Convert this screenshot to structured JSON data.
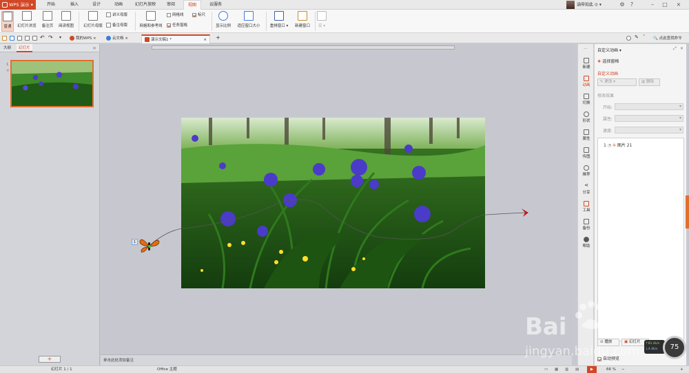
{
  "app": {
    "name": "WPS 演示",
    "user": "涵帝如此"
  },
  "menu": [
    "开始",
    "插入",
    "设计",
    "动画",
    "幻灯片放映",
    "审阅",
    "视图",
    "云服务"
  ],
  "active_menu": "视图",
  "ribbon": {
    "normal": "普通",
    "slide_sorter": "幻灯片浏览",
    "notes_page": "备注页",
    "reading_view": "阅读视图",
    "slide_master": "幻灯片母版",
    "handout_master": "讲义母版",
    "notes_master": "备注母版",
    "grid_guides": "网格和参考线",
    "gridlines": "网格线",
    "ruler": "标尺",
    "task_pane": "任务窗格",
    "zoom": "显示比例",
    "fit_window": "适应窗口大小",
    "arrange": "重排窗口",
    "new_window": "新建窗口",
    "macro": "宏"
  },
  "tabs": {
    "my_wps": "我的WPS",
    "cloud": "云文档",
    "document": "演示文稿1 *",
    "find": "点此查找命令"
  },
  "left_panel": {
    "outline": "大纲",
    "slides": "幻灯片",
    "slide_number": "1"
  },
  "canvas": {
    "notes_placeholder": "单击此处添加备注",
    "anim_badge": "1"
  },
  "sidebar": [
    "新建",
    "动画",
    "切换",
    "形状",
    "属性",
    "传图",
    "推荐",
    "分享",
    "工具",
    "备份",
    "帮助"
  ],
  "sidebar_active": "动画",
  "anim_pane": {
    "title": "自定义动画",
    "select_pane": "选择窗格",
    "section": "自定义动画",
    "change": "更改",
    "remove": "删除",
    "modify": "修改效果",
    "start": "开始:",
    "property": "属性:",
    "speed": "速度:",
    "item_number": "1",
    "item_name": "图片 21",
    "play": "播放",
    "slideshow": "幻灯片",
    "autopreview": "自动预览"
  },
  "statusbar": {
    "slide": "幻灯片 1 / 1",
    "theme": "Office 主题",
    "zoom": "66 %"
  },
  "watermark": {
    "brand": "Baidu经验",
    "url": "jingyan.baidu.com"
  },
  "overlay": {
    "zoom_badge": "75",
    "up": "↑81.4k/s",
    "down": "↓4.4k/s"
  },
  "colors": {
    "accent": "#d24726",
    "thumb_border": "#e0702e"
  }
}
